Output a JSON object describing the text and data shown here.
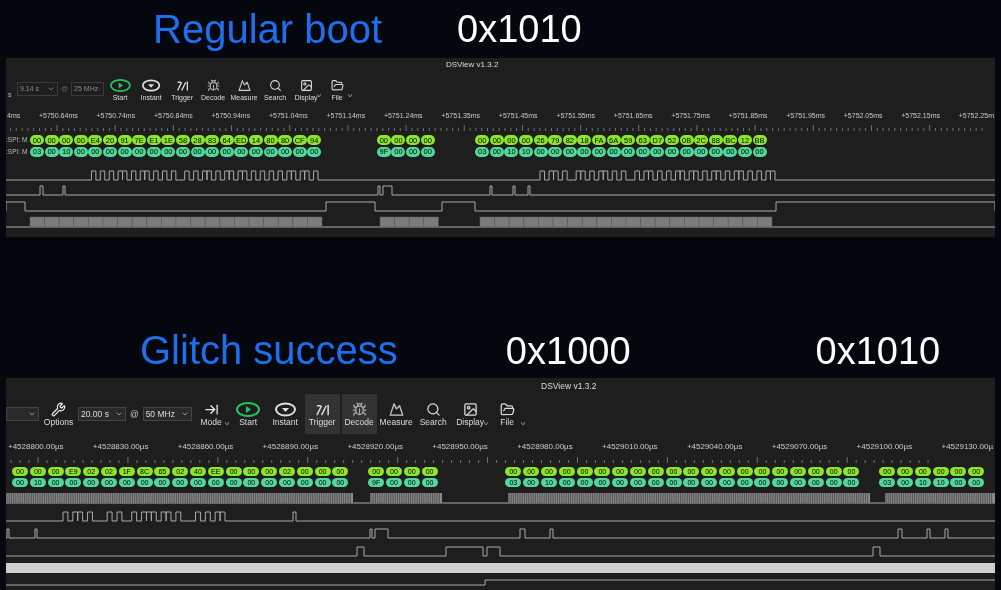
{
  "sections": [
    {
      "heading": "Regular boot",
      "values": [
        "0x1010"
      ],
      "window": {
        "title": "DSView v1.3.2",
        "toolbar": [
          {
            "kind": "label",
            "text": "s"
          },
          {
            "kind": "field",
            "value": "9.14 s",
            "disabled": true
          },
          {
            "kind": "at",
            "text": "@",
            "disabled": true
          },
          {
            "kind": "field",
            "value": "25 MHz",
            "disabled": true
          },
          {
            "kind": "start",
            "label": "Start",
            "active": false,
            "menu": false
          },
          {
            "kind": "instant",
            "label": "Instant",
            "active": false,
            "menu": false
          },
          {
            "kind": "trigger",
            "label": "Trigger",
            "active": false,
            "menu": false
          },
          {
            "kind": "decode",
            "label": "Decode",
            "active": false,
            "menu": false
          },
          {
            "kind": "measure",
            "label": "Measure",
            "active": false,
            "menu": false
          },
          {
            "kind": "search",
            "label": "Search",
            "active": false,
            "menu": false
          },
          {
            "kind": "display",
            "label": "Display",
            "active": false,
            "menu": true
          },
          {
            "kind": "file",
            "label": "File",
            "active": false,
            "menu": true
          }
        ],
        "ruler": [
          "4ms",
          "+5750.64ms",
          "+5750.74ms",
          "+5750.84ms",
          "+5750.94ms",
          "+5751.04ms",
          "+5751.14ms",
          "+5751.24ms",
          "+5751.35ms",
          "+5751.45ms",
          "+5751.55ms",
          "+5751.65ms",
          "+5751.75ms",
          "+5751.85ms",
          "+5751.95ms",
          "+5752.05ms",
          "+5752.15ms",
          "+5752.25m"
        ],
        "decode_rows": [
          {
            "label": ":SPI: M",
            "groups": [
              [
                "00",
                "00",
                "00",
                "00",
                "E4",
                "20",
                "91",
                "7E",
                "E1",
                "1E",
                "58",
                "28",
                "83",
                "64",
                "ED",
                "14",
                "80",
                "80",
                "CF",
                "94"
              ],
              [
                "00",
                "00",
                "00",
                "00"
              ],
              [
                "00",
                "00",
                "00",
                "00",
                "26",
                "79",
                "82",
                "18",
                "FA",
                "6A",
                "59",
                "63",
                "D7",
                "52",
                "0B",
                "2C",
                "88",
                "BC",
                "12",
                "BB"
              ]
            ]
          },
          {
            "label": ":SPI: M",
            "groups": [
              [
                "03",
                "00",
                "10",
                "00",
                "00",
                "00",
                "00",
                "00",
                "00",
                "00",
                "00",
                "00",
                "00",
                "00",
                "00",
                "00",
                "00",
                "00",
                "00",
                "00"
              ],
              [
                "9F",
                "00",
                "00",
                "00"
              ],
              [
                "03",
                "00",
                "10",
                "10",
                "00",
                "00",
                "00",
                "00",
                "00",
                "00",
                "00",
                "00",
                "00",
                "00",
                "00",
                "00",
                "00",
                "00",
                "00",
                "00"
              ]
            ]
          }
        ]
      }
    },
    {
      "heading": "Glitch success",
      "values": [
        "0x1000",
        "0x1010"
      ],
      "window": {
        "title": "DSView v1.3.2",
        "toolbar": [
          {
            "kind": "field",
            "disabled": false
          },
          {
            "kind": "options",
            "label": "Options",
            "active": false,
            "menu": false
          },
          {
            "kind": "field",
            "value": "20.00 s",
            "disabled": false
          },
          {
            "kind": "at",
            "text": "@",
            "disabled": false
          },
          {
            "kind": "field",
            "value": "50 MHz",
            "disabled": false
          },
          {
            "kind": "mode",
            "label": "Mode",
            "active": false,
            "menu": true
          },
          {
            "kind": "start",
            "label": "Start",
            "active": false,
            "menu": false
          },
          {
            "kind": "instant",
            "label": "Instant",
            "active": false,
            "menu": false
          },
          {
            "kind": "trigger",
            "label": "Trigger",
            "active": true,
            "menu": false
          },
          {
            "kind": "decode",
            "label": "Decode",
            "active": true,
            "menu": false
          },
          {
            "kind": "measure",
            "label": "Measure",
            "active": false,
            "menu": false
          },
          {
            "kind": "search",
            "label": "Search",
            "active": false,
            "menu": false
          },
          {
            "kind": "display",
            "label": "Display",
            "active": false,
            "menu": true
          },
          {
            "kind": "file",
            "label": "File",
            "active": false,
            "menu": true
          }
        ],
        "ruler": [
          "+4528800.00µs",
          "+4528830.00µs",
          "+4528860.00µs",
          "+4528890.00µs",
          "+4528920.00µs",
          "+4528950.00µs",
          "+4528980.00µs",
          "+4529010.00µs",
          "+4529040.00µs",
          "+4529070.00µs",
          "+4529100.00µs",
          "+4529130.00µ"
        ],
        "decode_rows": [
          {
            "groups": [
              [
                "00",
                "00",
                "00",
                "E9",
                "02",
                "02",
                "1F",
                "8C",
                "65",
                "02",
                "40",
                "EE",
                "00",
                "00",
                "00",
                "02",
                "00",
                "00",
                "00"
              ],
              [
                "00",
                "00",
                "00",
                "00"
              ],
              [
                "00",
                "00",
                "00",
                "00",
                "00",
                "00",
                "00",
                "00",
                "00",
                "00",
                "00",
                "00",
                "00",
                "00",
                "00",
                "00",
                "00",
                "00",
                "00",
                "00"
              ],
              [
                "00",
                "00",
                "00",
                "00",
                "00",
                "00"
              ]
            ]
          },
          {
            "groups": [
              [
                "00",
                "10",
                "00",
                "00",
                "00",
                "00",
                "00",
                "00",
                "00",
                "00",
                "00",
                "00",
                "00",
                "00",
                "00",
                "00",
                "00",
                "00",
                "00"
              ],
              [
                "9F",
                "00",
                "00",
                "00"
              ],
              [
                "03",
                "00",
                "10",
                "00",
                "00",
                "00",
                "00",
                "00",
                "00",
                "00",
                "00",
                "00",
                "00",
                "00",
                "00",
                "00",
                "00",
                "00",
                "00",
                "00"
              ],
              [
                "03",
                "00",
                "10",
                "10",
                "00",
                "00"
              ]
            ]
          }
        ]
      }
    }
  ]
}
